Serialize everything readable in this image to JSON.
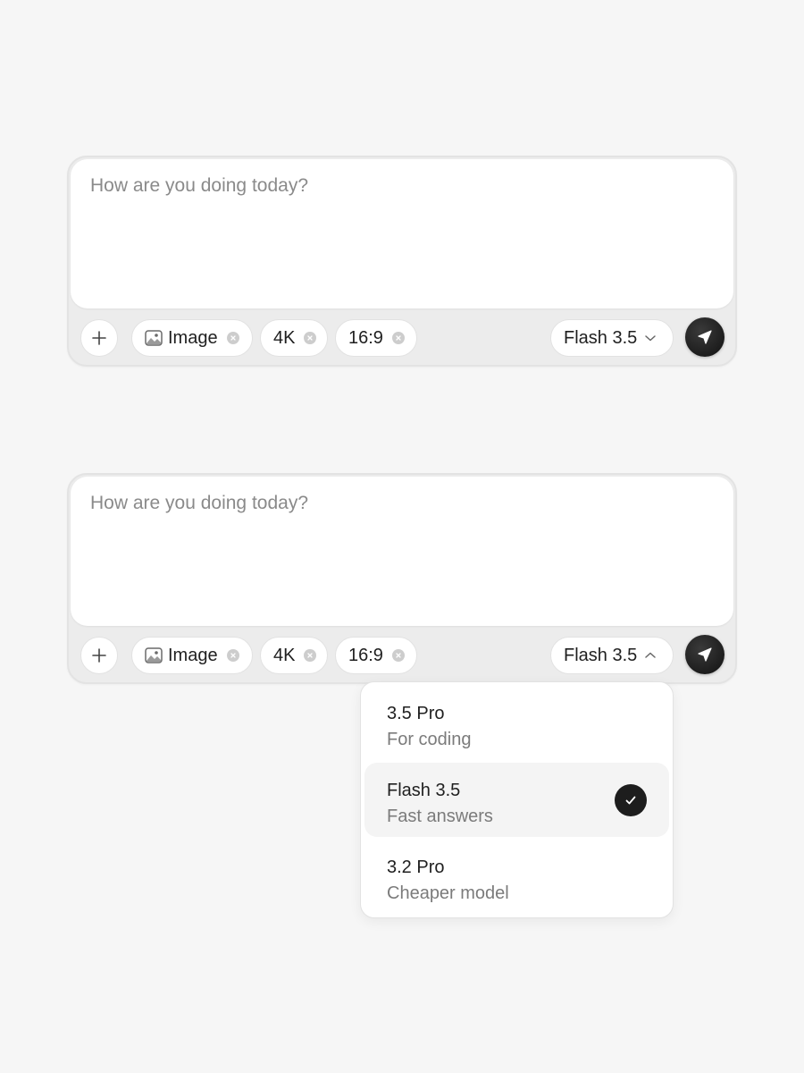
{
  "colors": {
    "page_background": "#f6f6f6",
    "composer_background": "#ececec",
    "send_button": "#1a1a1a",
    "selected_option_background": "#f4f4f4",
    "secondary_text": "#7b7b7b"
  },
  "composers": [
    {
      "input": {
        "value": "",
        "placeholder": "How are you doing today?"
      },
      "plus_button": {
        "icon": "plus-icon"
      },
      "chips": [
        {
          "label": "Image",
          "icon": "image-icon",
          "close_icon": "close-icon"
        },
        {
          "label": "4K",
          "close_icon": "close-icon"
        },
        {
          "label": "16:9",
          "close_icon": "close-icon"
        }
      ],
      "model_select": {
        "selected": "Flash 3.5",
        "icon": "chevron-down-icon",
        "open": false
      },
      "send_button": {
        "icon": "send-icon"
      }
    },
    {
      "input": {
        "value": "",
        "placeholder": "How are you doing today?"
      },
      "plus_button": {
        "icon": "plus-icon"
      },
      "chips": [
        {
          "label": "Image",
          "icon": "image-icon",
          "close_icon": "close-icon"
        },
        {
          "label": "4K",
          "close_icon": "close-icon"
        },
        {
          "label": "16:9",
          "close_icon": "close-icon"
        }
      ],
      "model_select": {
        "selected": "Flash 3.5",
        "icon": "chevron-up-icon",
        "open": true
      },
      "send_button": {
        "icon": "send-icon"
      }
    }
  ],
  "model_dropdown": {
    "options": [
      {
        "name": "3.5 Pro",
        "description": "For coding",
        "selected": false
      },
      {
        "name": "Flash 3.5",
        "description": "Fast answers",
        "selected": true,
        "icon": "check-icon"
      },
      {
        "name": "3.2 Pro",
        "description": "Cheaper model",
        "selected": false
      }
    ]
  }
}
